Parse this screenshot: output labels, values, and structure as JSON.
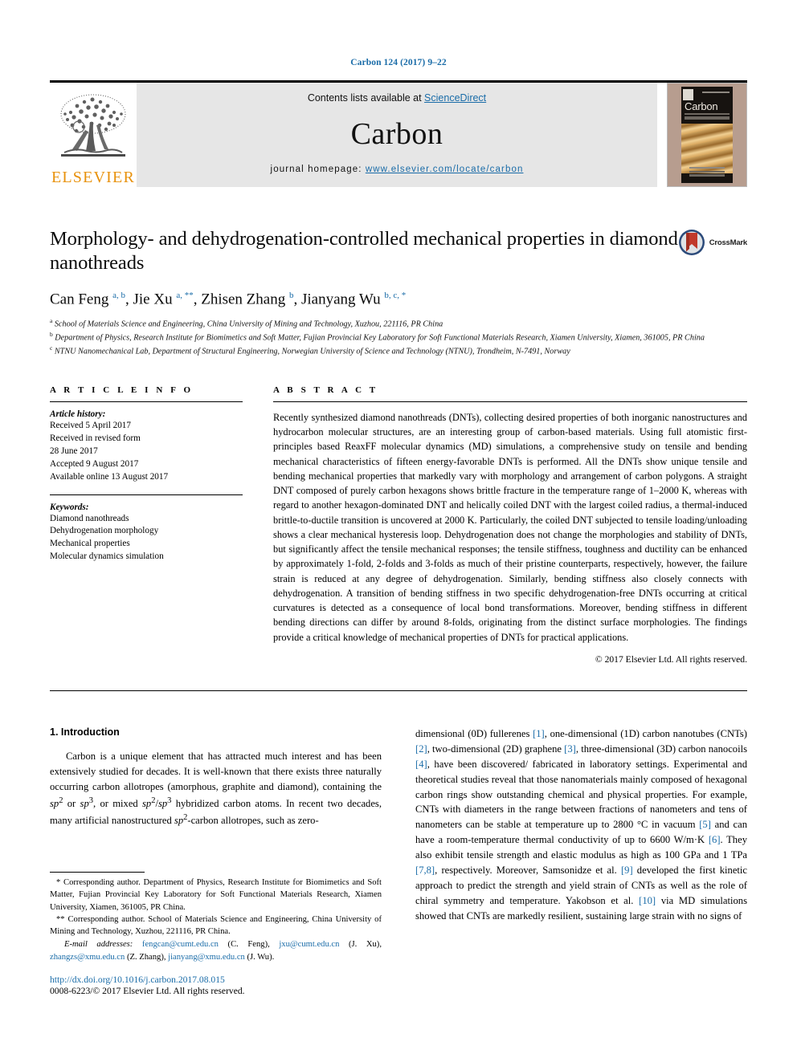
{
  "running_head": "Carbon 124 (2017) 9–22",
  "masthead": {
    "contents_prefix": "Contents lists available at ",
    "sciencedirect": "ScienceDirect",
    "journal_name": "Carbon",
    "homepage_prefix": "journal homepage: ",
    "homepage_url": "www.elsevier.com/locate/carbon",
    "publisher_logo_text": "ELSEVIER",
    "cover_title": "Carbon",
    "accent_link_color": "#1a6ca8",
    "elsevier_orange": "#e8910b"
  },
  "article": {
    "title": "Morphology- and dehydrogenation-controlled mechanical properties in diamond nanothreads",
    "crossmark_label": "CrossMark",
    "authors_html": "Can Feng <sup>a, b</sup>, Jie Xu <sup>a, **</sup>, Zhisen Zhang <sup>b</sup>, Jianyang Wu <sup>b, c, *</sup>",
    "affiliations": [
      {
        "marker": "a",
        "text": "School of Materials Science and Engineering, China University of Mining and Technology, Xuzhou, 221116, PR China"
      },
      {
        "marker": "b",
        "text": "Department of Physics, Research Institute for Biomimetics and Soft Matter, Fujian Provincial Key Laboratory for Soft Functional Materials Research, Xiamen University, Xiamen, 361005, PR China"
      },
      {
        "marker": "c",
        "text": "NTNU Nanomechanical Lab, Department of Structural Engineering, Norwegian University of Science and Technology (NTNU), Trondheim, N-7491, Norway"
      }
    ]
  },
  "article_info": {
    "heading": "A R T I C L E  I N F O",
    "history_label": "Article history:",
    "history_lines": [
      "Received 5 April 2017",
      "Received in revised form",
      "28 June 2017",
      "Accepted 9 August 2017",
      "Available online 13 August 2017"
    ],
    "keywords_label": "Keywords:",
    "keywords": [
      "Diamond nanothreads",
      "Dehydrogenation morphology",
      "Mechanical properties",
      "Molecular dynamics simulation"
    ]
  },
  "abstract": {
    "heading": "A B S T R A C T",
    "text": "Recently synthesized diamond nanothreads (DNTs), collecting desired properties of both inorganic nanostructures and hydrocarbon molecular structures, are an interesting group of carbon-based materials. Using full atomistic first-principles based ReaxFF molecular dynamics (MD) simulations, a comprehensive study on tensile and bending mechanical characteristics of fifteen energy-favorable DNTs is performed. All the DNTs show unique tensile and bending mechanical properties that markedly vary with morphology and arrangement of carbon polygons. A straight DNT composed of purely carbon hexagons shows brittle fracture in the temperature range of 1–2000 K, whereas with regard to another hexagon-dominated DNT and helically coiled DNT with the largest coiled radius, a thermal-induced brittle-to-ductile transition is uncovered at 2000 K. Particularly, the coiled DNT subjected to tensile loading/unloading shows a clear mechanical hysteresis loop. Dehydrogenation does not change the morphologies and stability of DNTs, but significantly affect the tensile mechanical responses; the tensile stiffness, toughness and ductility can be enhanced by approximately 1-fold, 2-folds and 3-folds as much of their pristine counterparts, respectively, however, the failure strain is reduced at any degree of dehydrogenation. Similarly, bending stiffness also closely connects with dehydrogenation. A transition of bending stiffness in two specific dehydrogenation-free DNTs occurring at critical curvatures is detected as a consequence of local bond transformations. Moreover, bending stiffness in different bending directions can differ by around 8-folds, originating from the distinct surface morphologies. The findings provide a critical knowledge of mechanical properties of DNTs for practical applications.",
    "copyright": "© 2017 Elsevier Ltd. All rights reserved."
  },
  "introduction": {
    "heading": "1. Introduction",
    "left_paragraph_html": "Carbon is a unique element that has attracted much interest and has been extensively studied for decades. It is well-known that there exists three naturally occurring carbon allotropes (amorphous, graphite and diamond), containing the <i>sp</i><sup>2</sup> or <i>sp</i><sup>3</sup>, or mixed <i>sp</i><sup>2</sup>/<i>sp</i><sup>3</sup> hybridized carbon atoms. In recent two decades, many artificial nanostructured <i>sp</i><sup>2</sup>-carbon allotropes, such as zero-",
    "right_paragraph_html": "dimensional (0D) fullerenes <span class=\"ref\">[1]</span>, one-dimensional (1D) carbon nanotubes (CNTs) <span class=\"ref\">[2]</span>, two-dimensional (2D) graphene <span class=\"ref\">[3]</span>, three-dimensional (3D) carbon nanocoils <span class=\"ref\">[4]</span>, have been discovered/ fabricated in laboratory settings. Experimental and theoretical studies reveal that those nanomaterials mainly composed of hexagonal carbon rings show outstanding chemical and physical properties. For example, CNTs with diameters in the range between fractions of nanometers and tens of nanometers can be stable at temperature up to 2800 &deg;C in vacuum <span class=\"ref\">[5]</span> and can have a room-temperature thermal conductivity of up to 6600 W/m&middot;K <span class=\"ref\">[6]</span>. They also exhibit tensile strength and elastic modulus as high as 100 GPa and 1 TPa <span class=\"ref\">[7,8]</span>, respectively. Moreover, Samsonidze et al. <span class=\"ref\">[9]</span> developed the first kinetic approach to predict the strength and yield strain of CNTs as well as the role of chiral symmetry and temperature. Yakobson et al. <span class=\"ref\">[10]</span> via MD simulations showed that CNTs are markedly resilient, sustaining large strain with no signs of"
  },
  "footnotes": {
    "corresponding_1_html": "* Corresponding author. Department of Physics, Research Institute for Biomimetics and Soft Matter, Fujian Provincial Key Laboratory for Soft Functional Materials Research, Xiamen University, Xiamen, 361005, PR China.",
    "corresponding_2_html": "** Corresponding author. School of Materials Science and Engineering, China University of Mining and Technology, Xuzhou, 221116, PR China.",
    "email_label": "E-mail addresses:",
    "emails_html": "<span class=\"mail\">fengcan@cumt.edu.cn</span> (C. Feng), <span class=\"mail\">jxu@cumt.edu.cn</span> (J. Xu), <span class=\"mail\">zhangzs@xmu.edu.cn</span> (Z. Zhang), <span class=\"mail\">jianyang@xmu.edu.cn</span> (J. Wu).",
    "doi_url": "http://dx.doi.org/10.1016/j.carbon.2017.08.015",
    "issn_line": "0008-6223/© 2017 Elsevier Ltd. All rights reserved."
  }
}
